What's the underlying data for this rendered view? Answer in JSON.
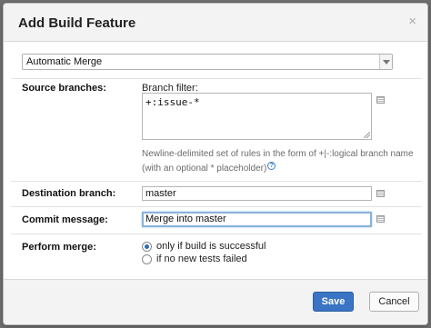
{
  "dialog": {
    "title": "Add Build Feature",
    "close_glyph": "×",
    "feature_select": {
      "value": "Automatic Merge"
    },
    "source_branches": {
      "label": "Source branches:",
      "filter_label": "Branch filter:",
      "filter_value": "+:issue-*",
      "hint": "Newline-delimited set of rules in the form of +|-:logical branch name (with an optional * placeholder)"
    },
    "destination_branch": {
      "label": "Destination branch:",
      "value": "master"
    },
    "commit_message": {
      "label": "Commit message:",
      "value": "Merge into master"
    },
    "perform_merge": {
      "label": "Perform merge:",
      "options": [
        {
          "label": "only if build is successful",
          "checked": true
        },
        {
          "label": "if no new tests failed",
          "checked": false
        }
      ]
    },
    "buttons": {
      "save": "Save",
      "cancel": "Cancel"
    }
  },
  "colors": {
    "accent": "#3b74c4",
    "focus": "#8ab3db"
  },
  "icons": {
    "help": "question-circle",
    "edit": "text-edit-icon",
    "dropdown": "chevron-down"
  }
}
